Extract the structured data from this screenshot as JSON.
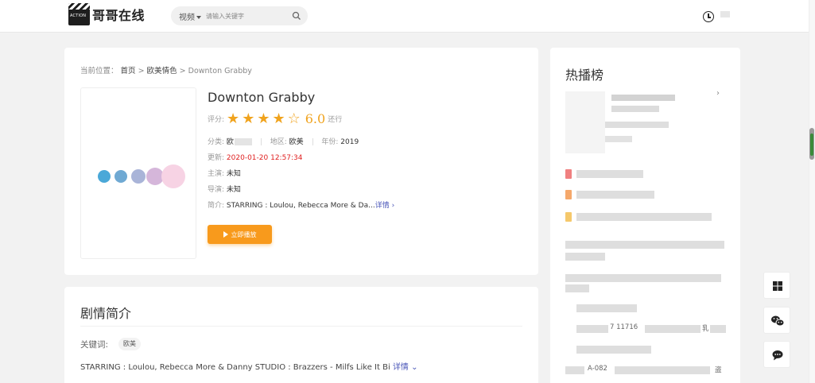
{
  "header": {
    "logo_badge": "ACTION",
    "site_name": "哥哥在线",
    "search_category": "视频",
    "search_placeholder": "请输入关键字"
  },
  "breadcrumb": {
    "prefix": "当前位置：",
    "home": "首页",
    "category": "欧美情色",
    "current": "Downton Grabby",
    "sep": ">"
  },
  "movie": {
    "title": "Downton Grabby",
    "rating_label": "评分:",
    "rating_stars": 4,
    "rating_max": 5,
    "score": "6.0",
    "score_word": "还行",
    "category_label": "分类:",
    "category_value": "欧",
    "region_label": "地区:",
    "region_value": "欧美",
    "year_label": "年份:",
    "year_value": "2019",
    "updated_label": "更新:",
    "updated_value": "2020-01-20 12:57:34",
    "cast_label": "主演:",
    "cast_value": "未知",
    "director_label": "导演:",
    "director_value": "未知",
    "intro_label": "简介:",
    "intro_value": "STARRING : Loulou, Rebecca More & Da...",
    "intro_more": "详情 ›",
    "play_button": "立即播放"
  },
  "poster_colors": [
    "#4aa8d8",
    "#6fa9d3",
    "#a9b4d8",
    "#d5b6da",
    "#f7d3e4"
  ],
  "synopsis": {
    "title": "剧情简介",
    "keywords_label": "关键词:",
    "keyword": "欧美",
    "text": "STARRING : Loulou, Rebecca More & Danny STUDIO : Brazzers - Milfs Like It Bi",
    "more": "详情 ⌄"
  },
  "hot": {
    "title": "热播榜",
    "arrow": "›",
    "row_a": "7 11716",
    "row_a_tail": "乳",
    "row_b": "A-082",
    "row_b_tail": "盗",
    "rank_colors": [
      "#f08080",
      "#f5a86b",
      "#f5c86b"
    ]
  },
  "accent_colors": {
    "orange": "#f89a1c",
    "star": "#f0a31e",
    "red": "#e02020",
    "link": "#4a56b8"
  }
}
